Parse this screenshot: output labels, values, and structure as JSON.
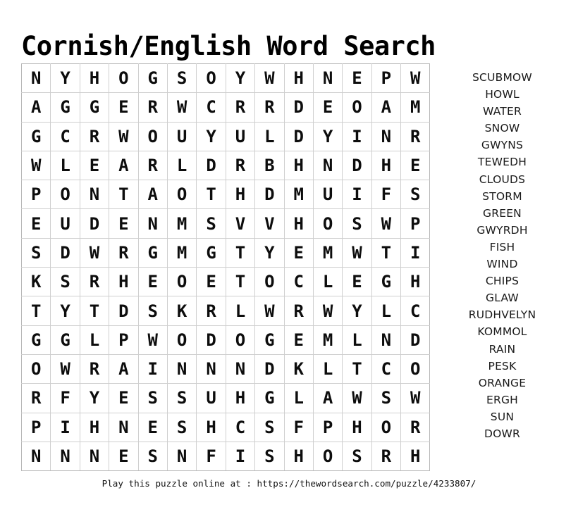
{
  "page": {
    "title": "Cornish/English Word Search",
    "footer": "Play this puzzle online at : https://thewordsearch.com/puzzle/4233807/",
    "background_color": "#ffffff",
    "text_color": "#000000",
    "grid_border_color": "#cfcfcf"
  },
  "grid": {
    "rows": 14,
    "cols": 14,
    "letters": [
      [
        "N",
        "Y",
        "H",
        "O",
        "G",
        "S",
        "O",
        "Y",
        "W",
        "H",
        "N",
        "E",
        "P",
        "W"
      ],
      [
        "A",
        "G",
        "G",
        "E",
        "R",
        "W",
        "C",
        "R",
        "R",
        "D",
        "E",
        "O",
        "A",
        "M"
      ],
      [
        "G",
        "C",
        "R",
        "W",
        "O",
        "U",
        "Y",
        "U",
        "L",
        "D",
        "Y",
        "I",
        "N",
        "R"
      ],
      [
        "W",
        "L",
        "E",
        "A",
        "R",
        "L",
        "D",
        "R",
        "B",
        "H",
        "N",
        "D",
        "H",
        "E"
      ],
      [
        "P",
        "O",
        "N",
        "T",
        "A",
        "O",
        "T",
        "H",
        "D",
        "M",
        "U",
        "I",
        "F",
        "S"
      ],
      [
        "E",
        "U",
        "D",
        "E",
        "N",
        "M",
        "S",
        "V",
        "V",
        "H",
        "O",
        "S",
        "W",
        "P"
      ],
      [
        "S",
        "D",
        "W",
        "R",
        "G",
        "M",
        "G",
        "T",
        "Y",
        "E",
        "M",
        "W",
        "T",
        "I"
      ],
      [
        "K",
        "S",
        "R",
        "H",
        "E",
        "O",
        "E",
        "T",
        "O",
        "C",
        "L",
        "E",
        "G",
        "H"
      ],
      [
        "T",
        "Y",
        "T",
        "D",
        "S",
        "K",
        "R",
        "L",
        "W",
        "R",
        "W",
        "Y",
        "L",
        "C"
      ],
      [
        "G",
        "G",
        "L",
        "P",
        "W",
        "O",
        "D",
        "O",
        "G",
        "E",
        "M",
        "L",
        "N",
        "D"
      ],
      [
        "O",
        "W",
        "R",
        "A",
        "I",
        "N",
        "N",
        "N",
        "D",
        "K",
        "L",
        "T",
        "C",
        "O"
      ],
      [
        "R",
        "F",
        "Y",
        "E",
        "S",
        "S",
        "U",
        "H",
        "G",
        "L",
        "A",
        "W",
        "S",
        "W"
      ],
      [
        "P",
        "I",
        "H",
        "N",
        "E",
        "S",
        "H",
        "C",
        "S",
        "F",
        "P",
        "H",
        "O",
        "R"
      ],
      [
        "N",
        "N",
        "N",
        "E",
        "S",
        "N",
        "F",
        "I",
        "S",
        "H",
        "O",
        "S",
        "R",
        "H"
      ]
    ]
  },
  "word_list": {
    "words": [
      "SCUBMOW",
      "HOWL",
      "WATER",
      "SNOW",
      "GWYNS",
      "TEWEDH",
      "CLOUDS",
      "STORM",
      "GREEN",
      "GWYRDH",
      "FISH",
      "WIND",
      "CHIPS",
      "GLAW",
      "RUDHVELYN",
      "KOMMOL",
      "RAIN",
      "PESK",
      "ORANGE",
      "ERGH",
      "SUN",
      "DOWR"
    ]
  }
}
